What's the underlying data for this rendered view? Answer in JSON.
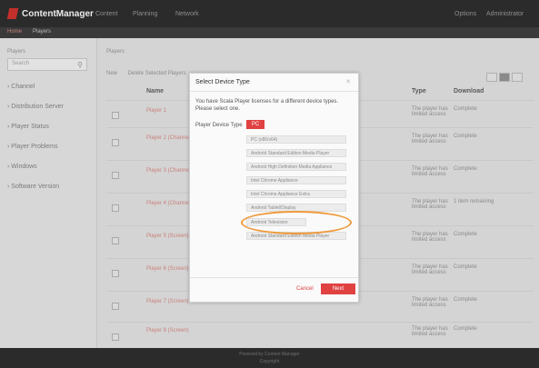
{
  "app": {
    "brand": "ContentManager",
    "nav": [
      "Content",
      "Planning",
      "Network"
    ],
    "user_items": [
      "Options",
      "Administrator"
    ]
  },
  "breadcrumb": {
    "root": "Home",
    "current": "Players"
  },
  "sidebar": {
    "heading": "Players",
    "search_placeholder": "Search",
    "items": [
      "Channel",
      "Distribution Server",
      "Player Status",
      "Player Problems",
      "Windows",
      "Software Version"
    ]
  },
  "main": {
    "heading": "Players",
    "toolbar": [
      "New",
      "Delete Selected Players"
    ],
    "columns": [
      "Name",
      "Type",
      "Download"
    ],
    "rows": [
      {
        "name": "Player 1",
        "type": "The player has limited access",
        "download": "Complete"
      },
      {
        "name": "Player 2 (Channel)",
        "type": "The player has limited access",
        "download": "Complete"
      },
      {
        "name": "Player 3 (Channel)",
        "type": "The player has limited access",
        "download": "Complete"
      },
      {
        "name": "Player 4 (Channel)",
        "type": "The player has limited access",
        "download": "1 item remaining"
      },
      {
        "name": "Player 5 (Screen)",
        "type": "The player has limited access",
        "download": "Complete"
      },
      {
        "name": "Player 6 (Screen)",
        "type": "The player has limited access",
        "download": "Complete"
      },
      {
        "name": "Player 7 (Screen)",
        "type": "The player has limited access",
        "download": "Complete"
      },
      {
        "name": "Player 8 (Screen)",
        "type": "The player has limited access",
        "download": "Complete"
      }
    ]
  },
  "modal": {
    "title": "Select Device Type",
    "message": "You have Scala Player licenses for a different device types. Please select one.",
    "device_label": "Player Device Type",
    "selected": "PC",
    "options": [
      "PC (x86/x64)",
      "Android Standard Edition Media Player",
      "Android High Definition Media Appliance",
      "Intel Chrome Appliance",
      "Intel Chrome Appliance Extra",
      "Android Tablet/Display",
      "Android Television",
      "Android Standard Edition Media Player"
    ],
    "cancel_label": "Cancel",
    "next_label": "Next"
  },
  "footer": {
    "line1": "Powered by Content Manager",
    "line2": "Copyright"
  },
  "colors": {
    "accent": "#e04141",
    "highlight": "#ef9a3b",
    "chrome": "#2b2b2b"
  }
}
